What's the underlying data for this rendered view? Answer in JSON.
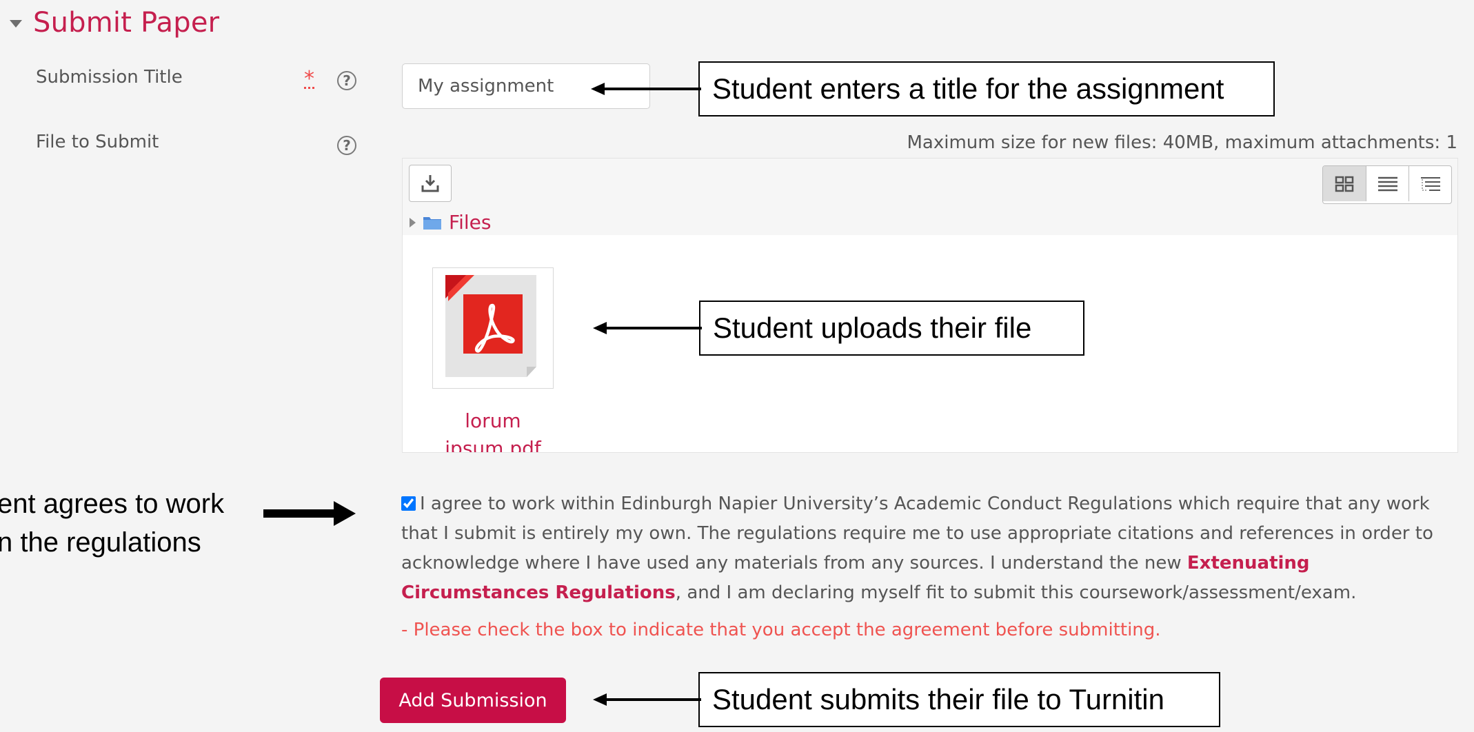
{
  "section": {
    "title": "Submit Paper"
  },
  "form": {
    "submission_title_label": "Submission Title",
    "required_marker": "*",
    "help_glyph": "?",
    "title_value": "My assignment",
    "file_label": "File to Submit",
    "max_size_text": "Maximum size for new files: 40MB, maximum attachments: 1",
    "folder_label": "Files",
    "file": {
      "name_line1": "lorum",
      "name_line2": "ipsum.pdf",
      "icon": "pdf-file-icon"
    },
    "agreement": {
      "checked": true,
      "text_before_link": "I agree to work within Edinburgh Napier University’s Academic Conduct Regulations which require that any work that I submit is entirely my own. The regulations require me to use appropriate citations and references in order to acknowledge where I have used any materials from any sources. I understand the new ",
      "link_text": "Extenuating Circumstances Regulations",
      "text_after_link": ", and I am declaring myself fit to submit this coursework/assessment/exam."
    },
    "error_text": "- Please check the box to indicate that you accept the agreement before submitting.",
    "submit_label": "Add Submission"
  },
  "annotations": {
    "title_callout": "Student enters a title for the assignment",
    "upload_callout": "Student uploads their file",
    "submit_callout": "Student submits their file to Turnitin",
    "agree_line1": "ent agrees to work",
    "agree_line2": "n the regulations"
  },
  "colors": {
    "accent": "#c51f4e",
    "button": "#c70e46",
    "error": "#ef5350",
    "label": "#555555"
  }
}
